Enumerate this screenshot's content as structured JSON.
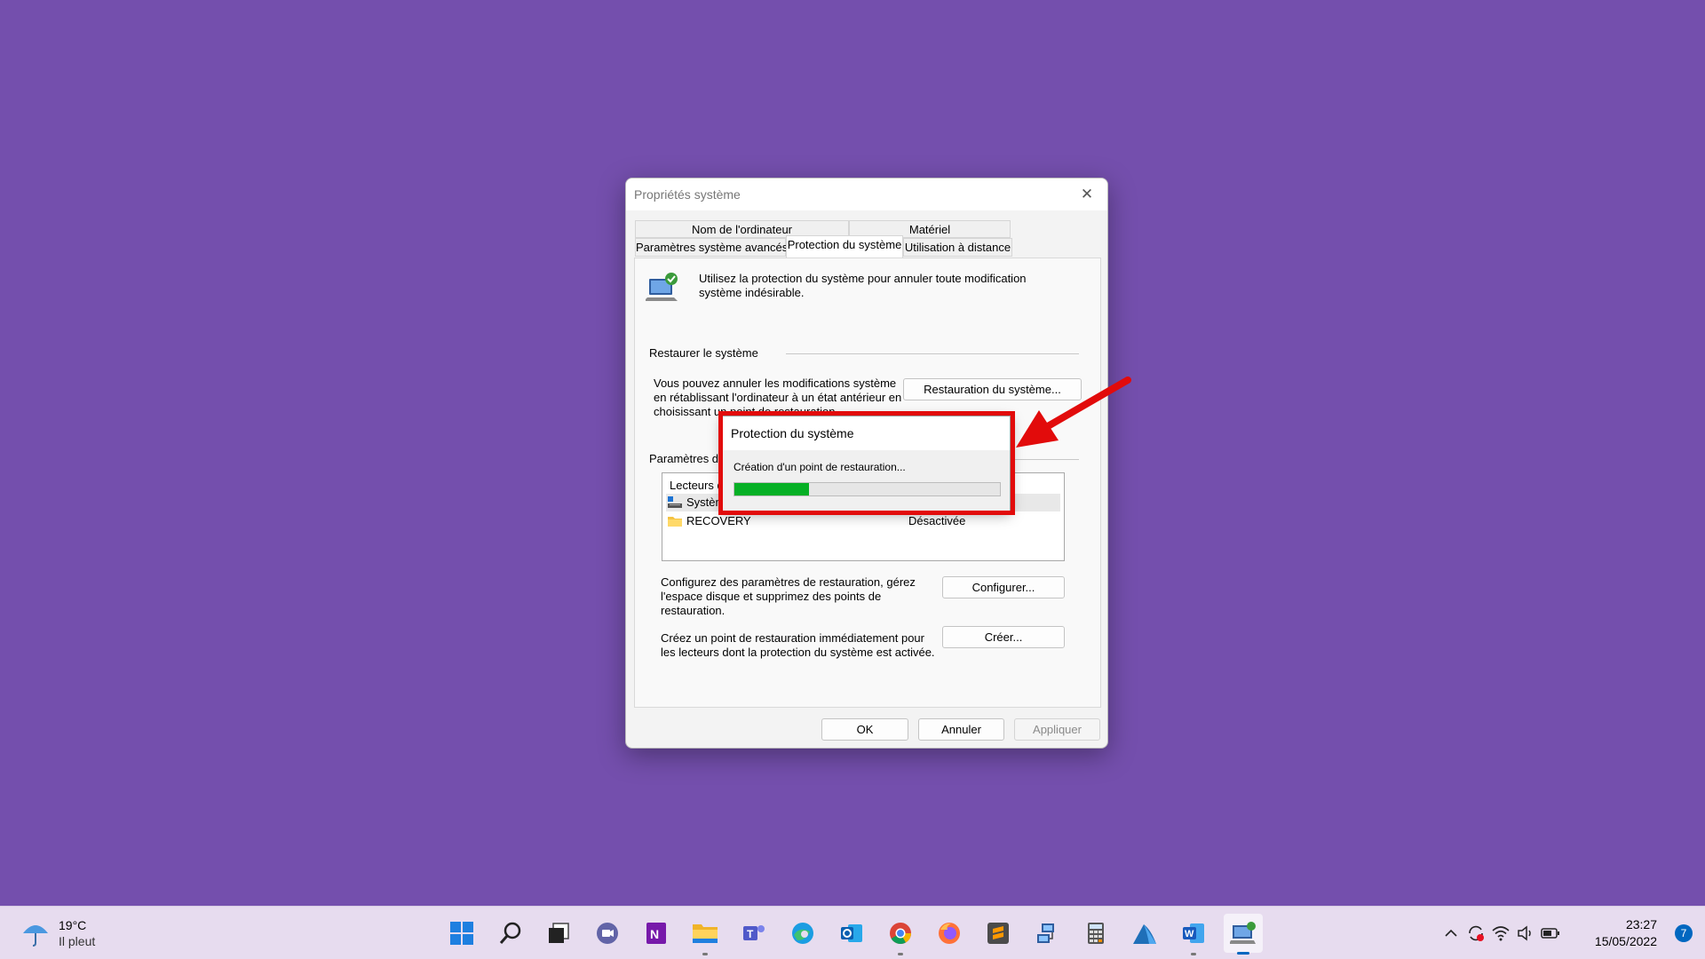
{
  "dialog": {
    "title": "Propriétés système",
    "tabs_row1": [
      "Nom de l'ordinateur",
      "Matériel"
    ],
    "tabs_row2": [
      "Paramètres système avancés",
      "Protection du système",
      "Utilisation à distance"
    ],
    "intro": "Utilisez la protection du système pour annuler toute modification système indésirable.",
    "restore_section": "Restaurer le système",
    "restore_text": "Vous pouvez annuler les modifications système en rétablissant l'ordinateur à un état antérieur en choisissant un point de restauration.",
    "restore_button": "Restauration du système...",
    "params_section": "Paramètres de protection",
    "list_header": "Lecteurs disponibles",
    "drives": [
      {
        "name": "Système",
        "status": ""
      },
      {
        "name": "RECOVERY",
        "status": "Désactivée"
      }
    ],
    "configure_text": "Configurez des paramètres de restauration, gérez l'espace disque et supprimez des points de restauration.",
    "configure_button": "Configurer...",
    "create_text": "Créez un point de restauration immédiatement pour les lecteurs dont la protection du système est activée.",
    "create_button": "Créer...",
    "ok": "OK",
    "cancel": "Annuler",
    "apply": "Appliquer"
  },
  "progress": {
    "title": "Protection du système",
    "message": "Création d'un point de restauration...",
    "fraction": 0.28,
    "fill_color": "#06b025",
    "highlight_color": "#e20b0b"
  },
  "taskbar": {
    "weather_temp": "19°C",
    "weather_desc": "Il pleut",
    "apps": [
      "start-icon",
      "search-icon",
      "task-view-icon",
      "teams-chat-icon",
      "onenote-icon",
      "file-explorer-icon",
      "teams-icon",
      "edge-icon",
      "outlook-icon",
      "chrome-icon",
      "firefox-icon",
      "sublime-text-icon",
      "network-icon",
      "calculator-icon",
      "app-icon",
      "word-icon",
      "system-properties-icon"
    ],
    "time": "23:27",
    "date": "15/05/2022",
    "notifications": "7"
  },
  "colors": {
    "desktop": "#744fad",
    "taskbar": "#e7dcef",
    "accent": "#0067c0"
  }
}
